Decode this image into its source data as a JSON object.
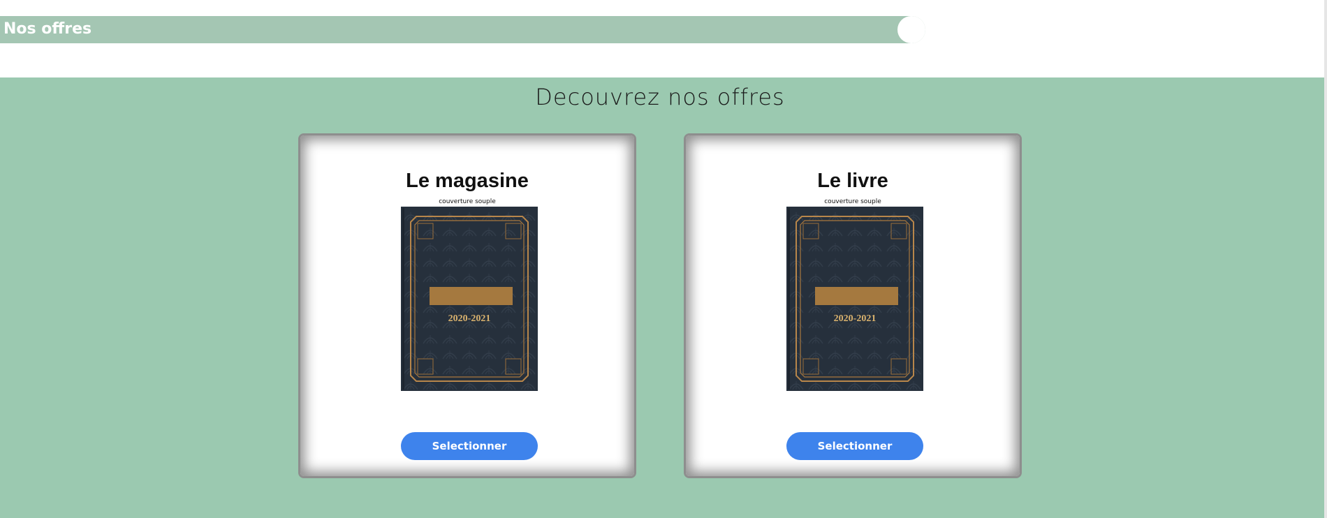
{
  "header": {
    "title": "Nos offres"
  },
  "section": {
    "title": "Decouvrez nos offres"
  },
  "offers": [
    {
      "title": "Le magasine",
      "subtitle": "couverture souple",
      "cover_text": "2020-2021",
      "button_label": "Selectionner"
    },
    {
      "title": "Le livre",
      "subtitle": "couverture souple",
      "cover_text": "2020-2021",
      "button_label": "Selectionner"
    }
  ],
  "colors": {
    "header_bar": "#a4c6b3",
    "section_bg": "#9bc9b0",
    "button": "#3e83ec",
    "cover_bg": "#26303c",
    "cover_gold": "#b8864a"
  }
}
